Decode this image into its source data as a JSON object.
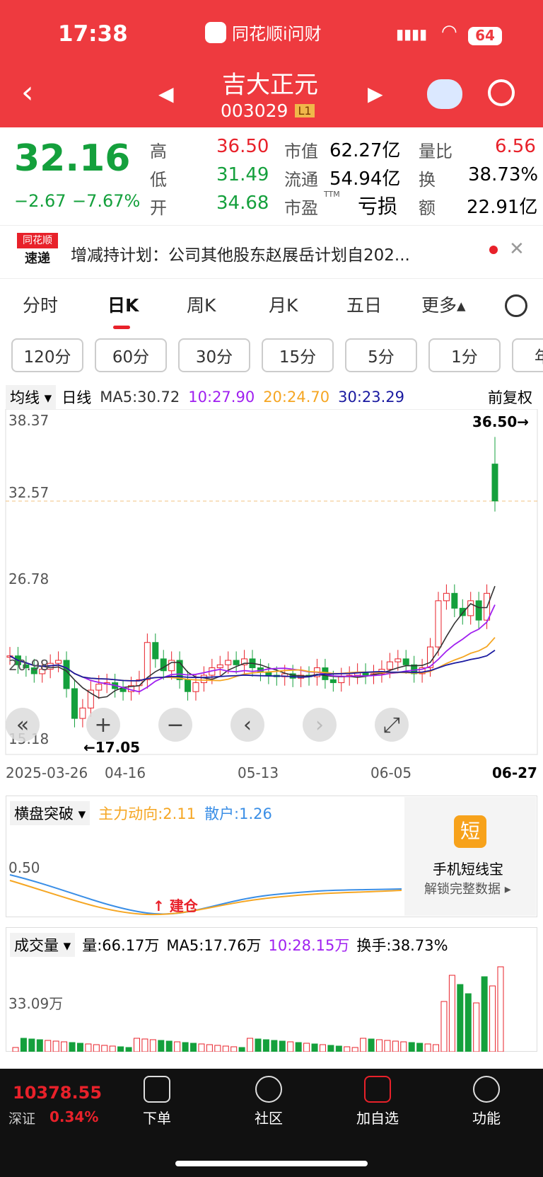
{
  "status": {
    "time": "17:38",
    "app_title": "同花顺i问财",
    "battery": "64"
  },
  "header": {
    "stock_name": "吉大正元",
    "stock_code": "003029",
    "level": "L1"
  },
  "quote": {
    "price": "32.16",
    "change": "−2.67",
    "change_pct": "−7.67%",
    "high_label": "高",
    "high": "36.50",
    "low_label": "低",
    "low": "31.49",
    "open_label": "开",
    "open": "34.68",
    "mcap_label": "市值",
    "mcap": "62.27亿",
    "float_label": "流通",
    "float": "54.94亿",
    "pe_label": "市盈",
    "pe_sup": "TTM",
    "pe": "亏损",
    "vr_label": "量比",
    "vr": "6.56",
    "turn_label": "换",
    "turn": "38.73%",
    "amt_label": "额",
    "amt": "22.91亿"
  },
  "news": {
    "badge_top": "同花顺",
    "badge_bottom": "速递",
    "text": "增减持计划：公司其他股东赵展岳计划自202..."
  },
  "tabs": [
    "分时",
    "日K",
    "周K",
    "月K",
    "五日",
    "更多▴"
  ],
  "periods": [
    "120分",
    "60分",
    "30分",
    "15分",
    "5分",
    "1分",
    "年"
  ],
  "ma": {
    "type": "均线",
    "period": "日线",
    "ma5": "MA5:30.72",
    "ma10": "10:27.90",
    "ma20": "20:24.70",
    "ma30": "30:23.29",
    "adjust": "前复权"
  },
  "kline": {
    "y_labels": [
      "38.37",
      "32.57",
      "26.78",
      "20.98",
      "15.18"
    ],
    "high_mark": "36.50→",
    "low_mark": "←17.05",
    "dates": [
      "2025-03-26",
      "04-16",
      "05-13",
      "06-05",
      "06-27"
    ]
  },
  "indicator": {
    "name": "横盘突破",
    "main": "主力动向:2.11",
    "retail": "散户:1.26",
    "level": "0.50",
    "signal": "建仓",
    "promo_title": "手机短线宝",
    "promo_sub": "解锁完整数据 ▸",
    "promo_icon": "短"
  },
  "volume": {
    "name": "成交量",
    "vol": "量:66.17万",
    "ma5": "MA5:17.76万",
    "ma10": "10:28.15万",
    "turn": "换手:38.73%",
    "level": "33.09万"
  },
  "bottom": {
    "index": "10378.55",
    "index_name": "深证",
    "index_pct": "0.34%",
    "items": [
      "下单",
      "社区",
      "加自选",
      "功能"
    ]
  },
  "colors": {
    "header": "#ee3a3f",
    "up": "#e8212a",
    "down": "#14a03c",
    "ma5": "#333333",
    "ma10": "#a020f0",
    "ma20": "#f5a623",
    "ma30": "#1a1aa0"
  },
  "chart_data": {
    "type": "candlestick",
    "title": "吉大正元 日K",
    "ylim": [
      15.18,
      38.37
    ],
    "x_labels": [
      "2025-03-26",
      "04-16",
      "05-13",
      "06-05",
      "06-27"
    ],
    "last": {
      "open": 34.68,
      "high": 36.5,
      "low": 31.49,
      "close": 32.16
    },
    "ma_last": {
      "ma5": 30.72,
      "ma10": 27.9,
      "ma20": 24.7,
      "ma30": 23.29
    }
  }
}
